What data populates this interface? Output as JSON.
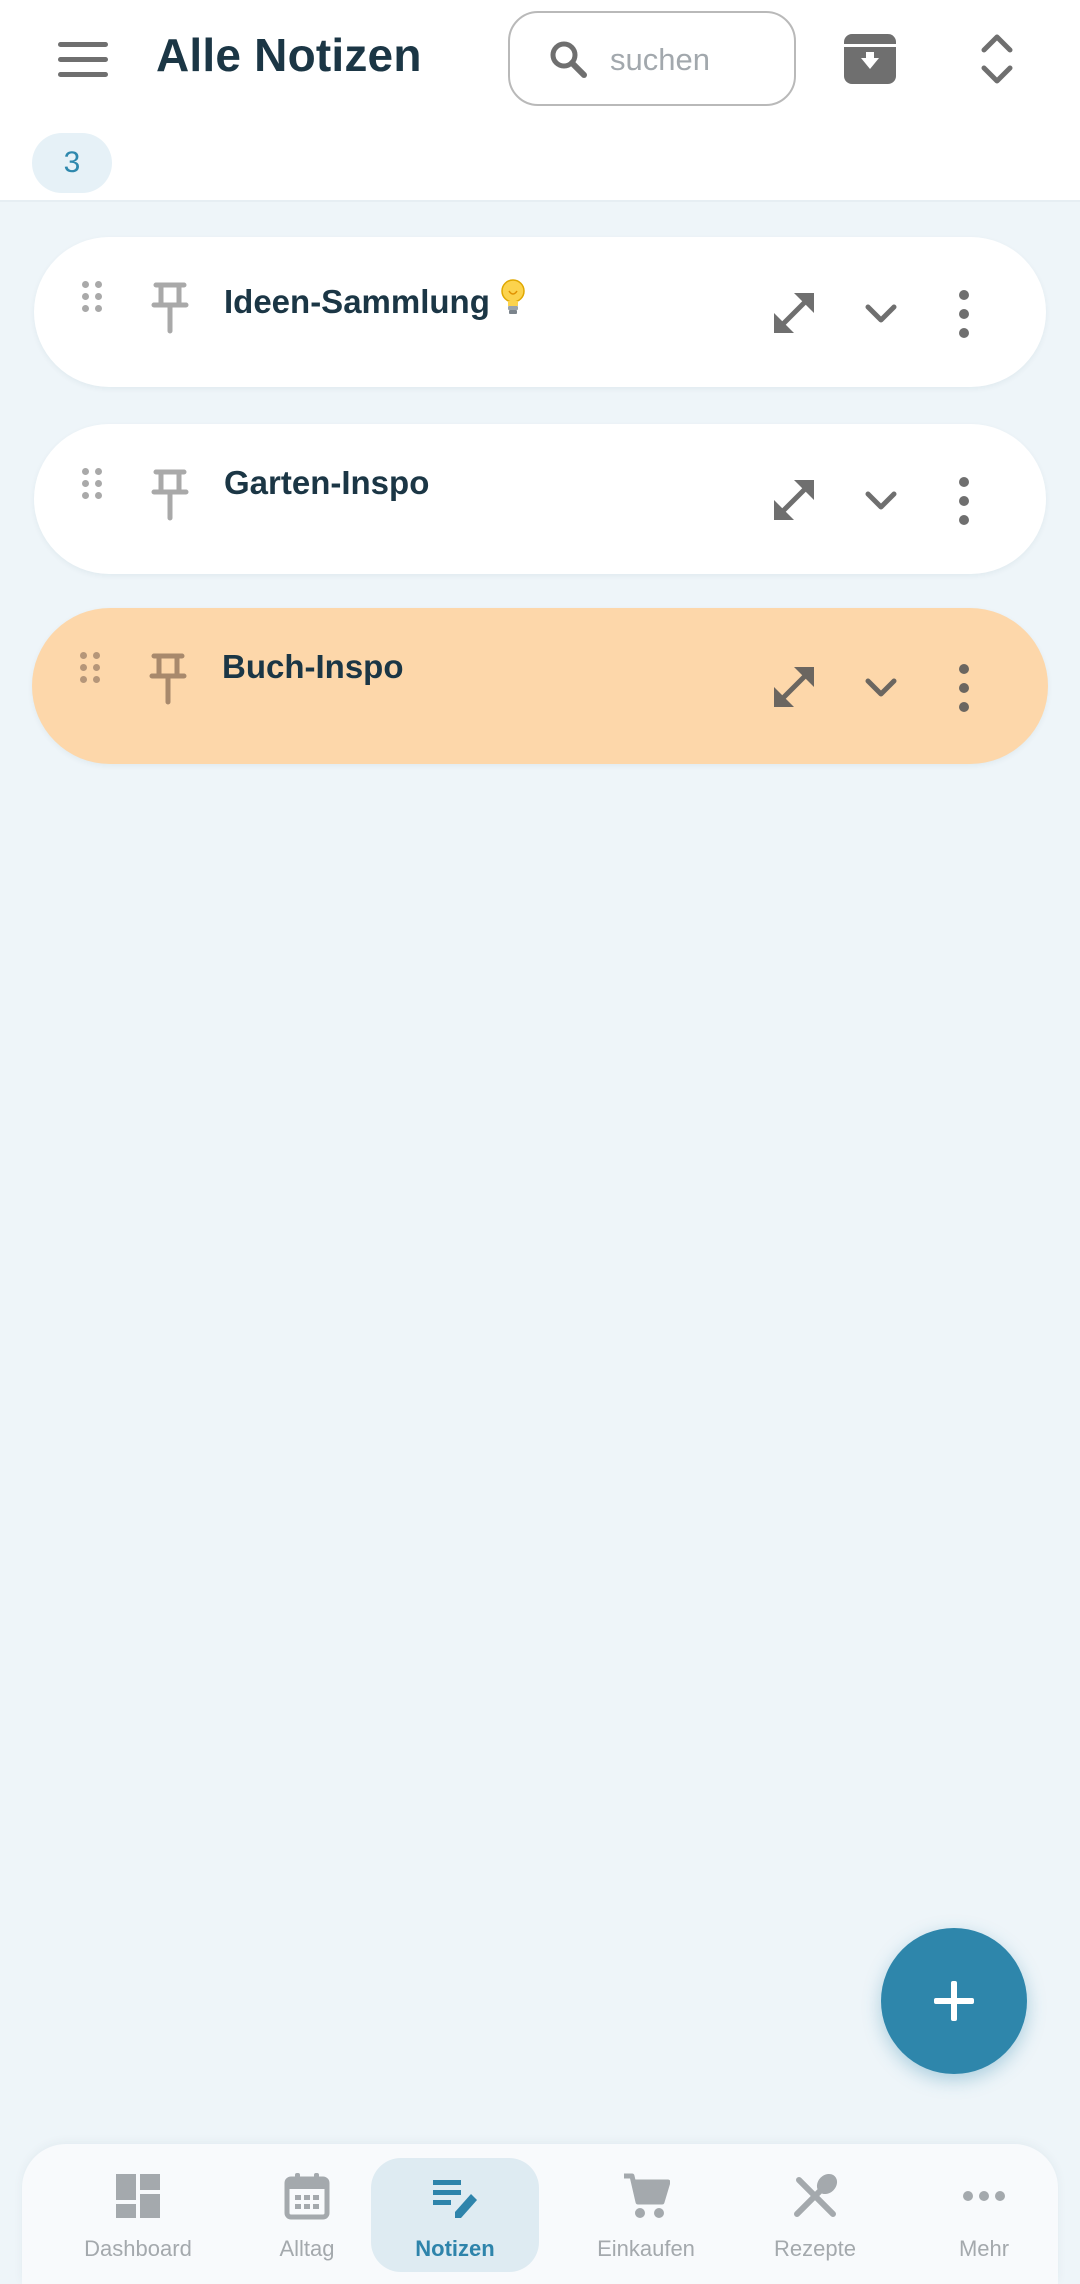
{
  "header": {
    "title": "Alle Notizen",
    "search_placeholder": "suchen",
    "count": "3"
  },
  "notes": [
    {
      "title": "Ideen-Sammlung",
      "emoji_icon": "lightbulb-emoji",
      "color": "#ffffff"
    },
    {
      "title": "Garten-Inspo",
      "color": "#ffffff"
    },
    {
      "title": "Buch-Inspo",
      "color": "#fdd7aa"
    }
  ],
  "bottom_nav": {
    "items": [
      {
        "label": "Dashboard",
        "icon": "dashboard-icon"
      },
      {
        "label": "Alltag",
        "icon": "calendar-icon"
      },
      {
        "label": "Notizen",
        "icon": "notes-icon",
        "active": true
      },
      {
        "label": "Einkaufen",
        "icon": "cart-icon"
      },
      {
        "label": "Rezepte",
        "icon": "utensils-icon"
      },
      {
        "label": "Mehr",
        "icon": "more-horizontal-icon"
      }
    ]
  },
  "colors": {
    "accent": "#2e86ab",
    "title_text": "#1b3645",
    "background": "#eef5f9",
    "highlight_note": "#fdd7aa"
  }
}
